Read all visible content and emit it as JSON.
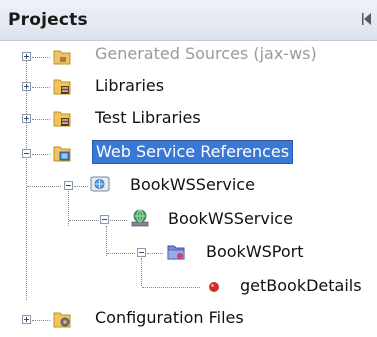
{
  "panel": {
    "title": "Projects"
  },
  "tree": {
    "generated_sources": "Generated Sources (jax-ws)",
    "libraries": "Libraries",
    "test_libraries": "Test Libraries",
    "web_service_references": "Web Service References",
    "bookws_service_1": "BookWSService",
    "bookws_service_2": "BookWSService",
    "bookws_port": "BookWSPort",
    "get_book_details": "getBookDetails",
    "configuration_files": "Configuration Files"
  },
  "colors": {
    "selection": "#3a78d6",
    "folder": "#e9b84a",
    "operation_dot": "#d0302b"
  },
  "icons": {
    "generated_sources": "folder-icon",
    "libraries": "library-folder-icon",
    "test_libraries": "library-folder-icon",
    "web_service_references": "web-service-folder-icon",
    "bookws_service_1": "web-service-icon",
    "bookws_service_2": "service-globe-icon",
    "bookws_port": "port-folder-icon",
    "get_book_details": "operation-icon",
    "configuration_files": "config-folder-icon"
  }
}
